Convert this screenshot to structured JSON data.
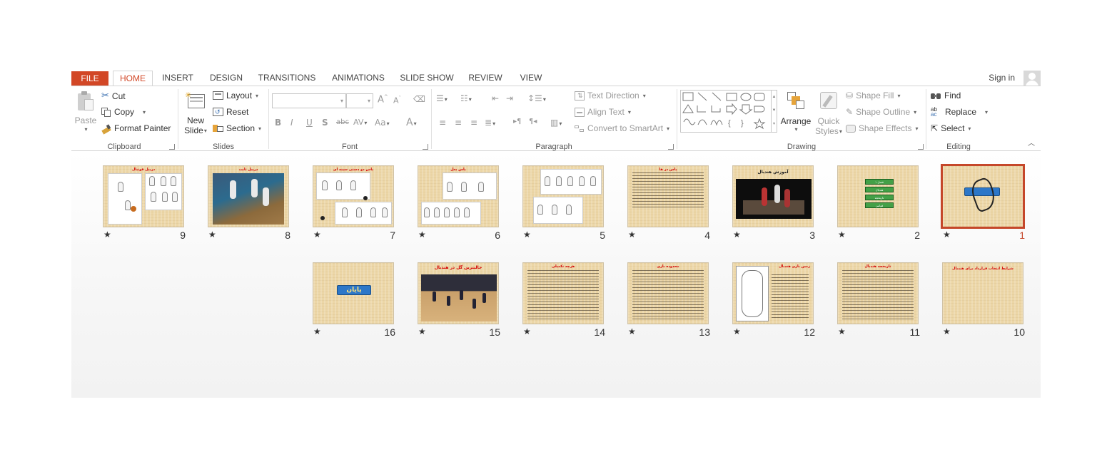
{
  "tabs": {
    "file": "FILE",
    "home": "HOME",
    "insert": "INSERT",
    "design": "DESIGN",
    "transitions": "TRANSITIONS",
    "animations": "ANIMATIONS",
    "slideshow": "SLIDE SHOW",
    "review": "REVIEW",
    "view": "VIEW"
  },
  "account": {
    "signin": "Sign in"
  },
  "clipboard": {
    "group": "Clipboard",
    "paste": "Paste",
    "cut": "Cut",
    "copy": "Copy",
    "format_painter": "Format Painter"
  },
  "slides_group": {
    "group": "Slides",
    "new_slide_1": "New",
    "new_slide_2": "Slide",
    "layout": "Layout",
    "reset": "Reset",
    "section": "Section"
  },
  "font_group": {
    "group": "Font",
    "font_name": "",
    "font_size": "",
    "grow": "A",
    "shrink": "A",
    "bold": "B",
    "italic": "I",
    "underline": "U",
    "shadow": "S",
    "strike": "abc",
    "spacing": "AV",
    "case": "Aa",
    "color": "A"
  },
  "paragraph": {
    "group": "Paragraph",
    "text_direction": "Text Direction",
    "align_text": "Align Text",
    "convert_smartart": "Convert to SmartArt"
  },
  "drawing": {
    "group": "Drawing",
    "arrange": "Arrange",
    "quick_1": "Quick",
    "quick_2": "Styles",
    "shape_fill": "Shape Fill",
    "shape_outline": "Shape Outline",
    "shape_effects": "Shape Effects"
  },
  "editing": {
    "group": "Editing",
    "find": "Find",
    "replace": "Replace",
    "select": "Select"
  },
  "slides": [
    {
      "num": "9",
      "title": "دریبل فوتبال",
      "kind": "figures"
    },
    {
      "num": "8",
      "title": "دریبل ثابت",
      "kind": "photo"
    },
    {
      "num": "7",
      "title": "پاس دو دستی سینه ای",
      "kind": "figures2"
    },
    {
      "num": "6",
      "title": "پاس بغل",
      "kind": "figures3"
    },
    {
      "num": "5",
      "title": "",
      "kind": "figures4"
    },
    {
      "num": "4",
      "title": "پاس در ها",
      "kind": "text"
    },
    {
      "num": "3",
      "title": "آموزش هندبال",
      "kind": "video"
    },
    {
      "num": "2",
      "title": "",
      "kind": "menu",
      "items": [
        "فصل ۱",
        "هندبال",
        "تاریخچه",
        "قوانین"
      ]
    },
    {
      "num": "1",
      "title": "",
      "kind": "calligraphy",
      "selected": true
    },
    {
      "num": "16",
      "title": "پایان",
      "kind": "end"
    },
    {
      "num": "15",
      "title": "جالبترین گل در هندبال",
      "kind": "photo2"
    },
    {
      "num": "14",
      "title": "هرچه تکمیلی",
      "kind": "text"
    },
    {
      "num": "13",
      "title": "محدوده بازی",
      "kind": "text"
    },
    {
      "num": "12",
      "title": "زمین بازی هندبال",
      "kind": "court"
    },
    {
      "num": "11",
      "title": "تاریخچه هندبال",
      "kind": "text"
    },
    {
      "num": "10",
      "title": "شرایط انتخاب قرارداد برای هندبال",
      "kind": "blank"
    }
  ],
  "star": "★"
}
